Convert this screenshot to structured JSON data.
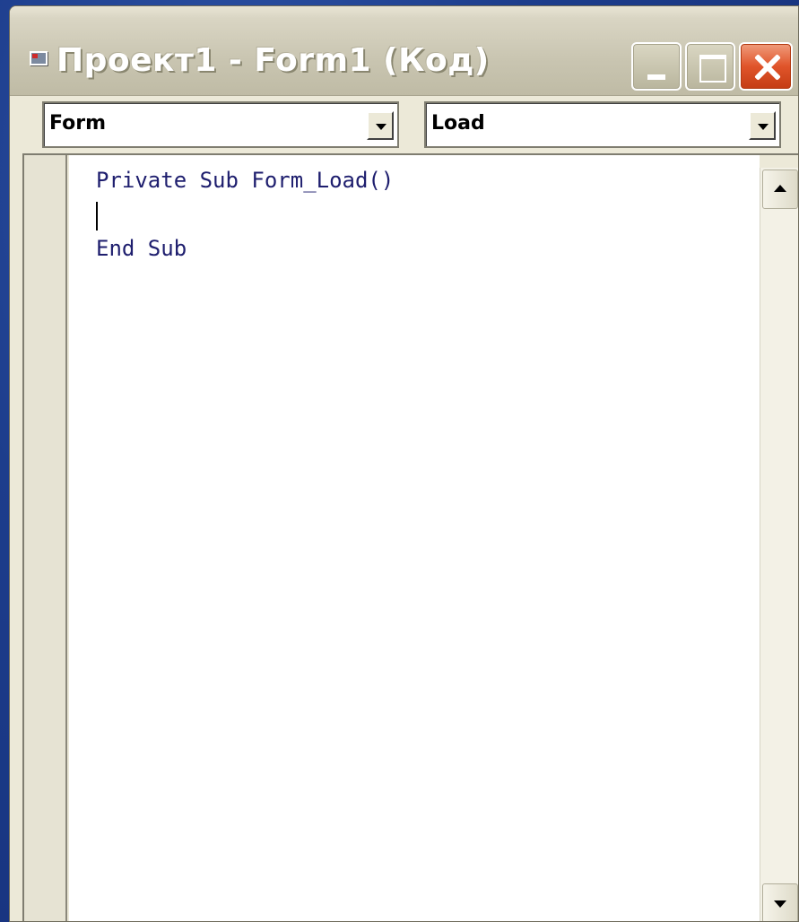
{
  "window": {
    "title": "Проект1 - Form1 (Код)"
  },
  "toolbar": {
    "object_combo_value": "Form",
    "procedure_combo_value": "Load"
  },
  "editor": {
    "lines": [
      "Private Sub Form_Load()",
      "",
      "End Sub"
    ],
    "code_color": "#1e1e6e"
  },
  "colors": {
    "desktop": "#17357f",
    "window_face": "#ece9d8",
    "close_button": "#e0542a"
  },
  "icons": {
    "title_icon": "vb-form-icon",
    "minimize": "minimize-icon",
    "maximize": "maximize-icon",
    "close": "close-icon",
    "combo_arrow": "chevron-down-icon",
    "scroll_up": "scroll-up-arrow-icon",
    "scroll_down": "scroll-down-arrow-icon"
  }
}
